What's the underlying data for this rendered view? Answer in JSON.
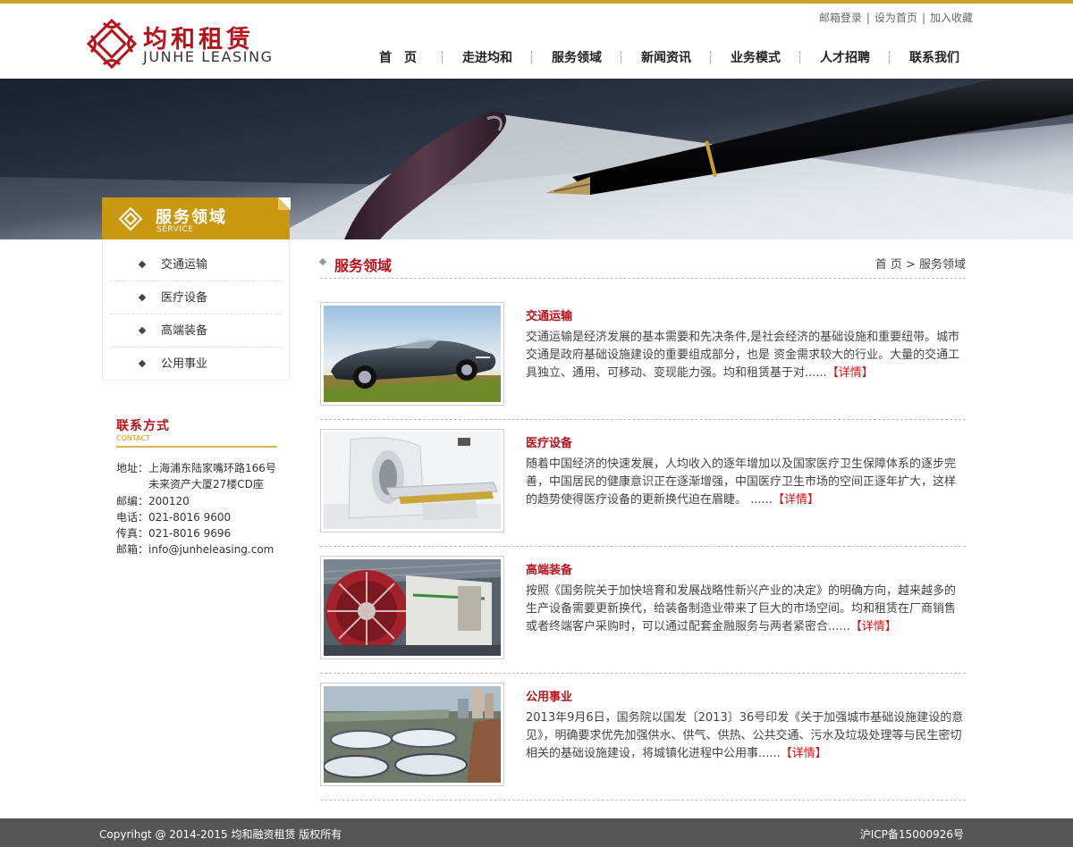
{
  "header": {
    "logo_cn": "均和租赁",
    "logo_en": "JUNHE LEASING",
    "top_links": [
      "邮箱登录",
      "设为首页",
      "加入收藏"
    ],
    "nav": [
      "首　页",
      "走进均和",
      "服务领域",
      "新闻资讯",
      "业务模式",
      "人才招聘",
      "联系我们"
    ]
  },
  "sidebar": {
    "title_cn": "服务领域",
    "title_en": "SERVICE",
    "items": [
      "交通运输",
      "医疗设备",
      "高端装备",
      "公用事业"
    ]
  },
  "contact": {
    "title": "联系方式",
    "title_en": "CONTACT",
    "address_1": "地址：上海浦东陆家嘴环路166号",
    "address_2": "未来资产大厦27楼CD座",
    "postcode": "邮编：200120",
    "phone": "电话：021-8016 9600",
    "fax": "传真：021-8016 9696",
    "email": "邮箱：info@junheleasing.com"
  },
  "main": {
    "title": "服务领域",
    "breadcrumb": "首 页 > 服务领域",
    "more_label": "【详情】",
    "items": [
      {
        "title": "交通运输",
        "desc": "交通运输是经济发展的基本需要和先决条件,是社会经济的基础设施和重要纽带。城市交通是政府基础设施建设的重要组成部分，也是 资金需求较大的行业。大量的交通工具独立、通用、可移动、变现能力强。均和租赁基于对......",
        "image": "car"
      },
      {
        "title": "医疗设备",
        "desc": "随着中国经济的快速发展，人均收入的逐年增加以及国家医疗卫生保障体系的逐步完善，中国居民的健康意识正在逐渐增强，中国医疗卫生市场的空间正逐年扩大，这样的趋势使得医疗设备的更新换代迫在眉睫。 ......",
        "image": "medical-scanner"
      },
      {
        "title": "高端装备",
        "desc": "按照《国务院关于加快培育和发展战略性新兴产业的决定》的明确方向，越来越多的生产设备需要更新换代，给装备制造业带来了巨大的市场空间。均和租赁在厂商销售或者终端客户采购时，可以通过配套金融服务与两者紧密合......",
        "image": "tunnel-boring-machine"
      },
      {
        "title": "公用事业",
        "desc": "2013年9月6日，国务院以国发〔2013〕36号印发《关于加强城市基础设施建设的意见》，明确要求优先加强供水、供气、供热、公共交通、污水及垃圾处理等与民生密切相关的基础设施建设，将城镇化进程中公用事......",
        "image": "water-treatment-plant"
      }
    ]
  },
  "footer": {
    "copyright": "Copyrihgt @ 2014-2015 均和融资租赁 版权所有",
    "icp": "沪ICP备15000926号"
  },
  "colors": {
    "brand_red": "#b8121b",
    "gold": "#c9980f",
    "footer_bg": "#555555"
  }
}
